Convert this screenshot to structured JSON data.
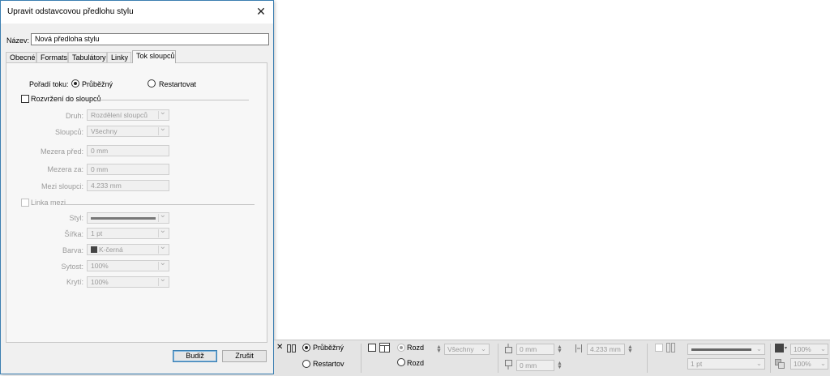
{
  "dialog": {
    "title": "Upravit odstavcovou předlohu stylu",
    "close_glyph": "✕",
    "name_label": "Název:",
    "name_value": "Nová předloha stylu",
    "tabs": [
      {
        "label": "Obecné"
      },
      {
        "label": "Formats"
      },
      {
        "label": "Tabulátory"
      },
      {
        "label": "Linky"
      },
      {
        "label": "Tok sloupců",
        "active": true
      }
    ],
    "flow": {
      "label": "Pořadí toku:",
      "option_continuous": "Průběžný",
      "option_restart": "Restartovat",
      "selected": "Průběžný"
    },
    "columns": {
      "checkbox_label": "Rozvržení do sloupců",
      "checked": false,
      "type_label": "Druh:",
      "type_value": "Rozdělení sloupců",
      "columns_label": "Sloupců:",
      "columns_value": "Všechny",
      "space_before_label": "Mezera před:",
      "space_before_value": "0 mm",
      "space_after_label": "Mezera za:",
      "space_after_value": "0 mm",
      "gutter_label": "Mezi sloupci:",
      "gutter_value": "4.233 mm"
    },
    "rule": {
      "checkbox_label": "Linka mezi",
      "checked": false,
      "style_label": "Styl:",
      "width_label": "Šířka:",
      "width_value": "1 pt",
      "color_label": "Barva:",
      "color_value": "K-černá",
      "tint_label": "Sytost:",
      "tint_value": "100%",
      "opacity_label": "Krytí:",
      "opacity_value": "100%"
    },
    "ok_label": "Budiž",
    "cancel_label": "Zrušit"
  },
  "control_bar": {
    "continuous_label": "Průběžný",
    "restart_label": "Restartov",
    "split_label_1": "Rozd",
    "split_label_2": "Rozd",
    "columns_value": "Všechny",
    "space_before_value": "0 mm",
    "space_after_value": "0 mm",
    "gutter_value": "4.233 mm",
    "rule_width_value": "1 pt",
    "tint_value": "100%",
    "opacity_value": "100%"
  },
  "colors": {
    "dialog_border": "#3c7fb1",
    "dialog_bg": "#f0f0f0",
    "panel_bg": "#f7f7f7",
    "disabled_text": "#9a9a9a",
    "control_bar_bg": "#e4e4e4"
  }
}
